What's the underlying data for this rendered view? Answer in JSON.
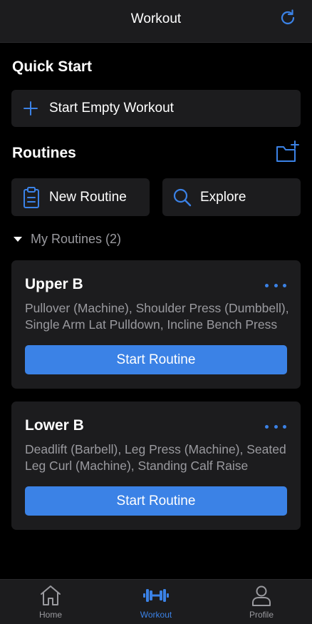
{
  "header": {
    "title": "Workout"
  },
  "quick_start": {
    "title": "Quick Start",
    "empty_workout_label": "Start Empty Workout"
  },
  "routines": {
    "title": "Routines",
    "new_routine_label": "New Routine",
    "explore_label": "Explore",
    "my_routines_label": "My Routines (2)"
  },
  "cards": [
    {
      "title": "Upper B",
      "description": "Pullover (Machine), Shoulder Press (Dumbbell), Single Arm Lat Pulldown, Incline Bench Press",
      "button_label": "Start Routine"
    },
    {
      "title": "Lower B",
      "description": "Deadlift (Barbell), Leg Press (Machine), Seated Leg Curl (Machine), Standing Calf Raise",
      "button_label": "Start Routine"
    }
  ],
  "tabbar": {
    "items": [
      {
        "label": "Home",
        "icon": "home-icon",
        "active": false
      },
      {
        "label": "Workout",
        "icon": "dumbbell-icon",
        "active": true
      },
      {
        "label": "Profile",
        "icon": "profile-icon",
        "active": false
      }
    ]
  },
  "colors": {
    "accent": "#3b82e6",
    "background": "#000000",
    "surface": "#1c1c1e",
    "text_primary": "#ffffff",
    "text_secondary": "#9a9a9f"
  }
}
